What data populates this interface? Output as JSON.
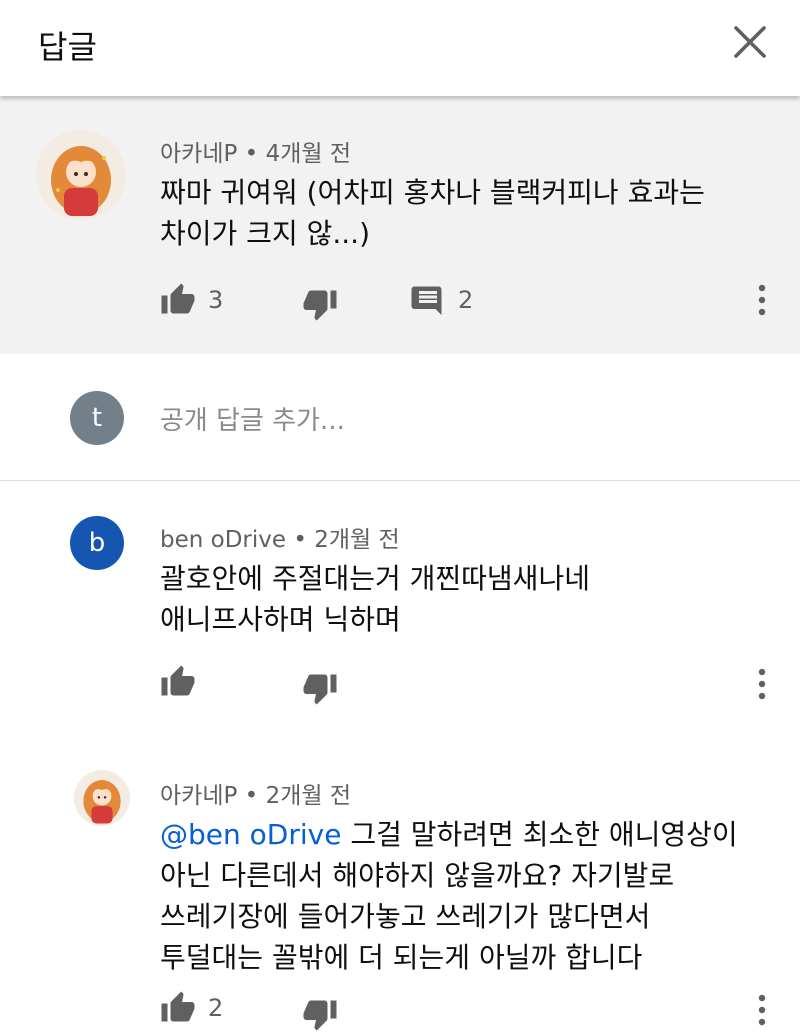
{
  "header": {
    "title": "답글"
  },
  "parent_comment": {
    "author": "아카네P",
    "time": "4개월 전",
    "text": "짜마 귀여워 (어차피 홍차나 블랙커피나 효과는\n차이가 크지 않...)",
    "likes": "3",
    "replies": "2"
  },
  "reply_input": {
    "avatar_letter": "t",
    "placeholder": "공개 답글 추가..."
  },
  "replies": [
    {
      "author": "ben oDrive",
      "time": "2개월 전",
      "avatar_letter": "b",
      "text": "괄호안에 주절대는거 개찐따냄새나네\n애니프사하며 닉하며"
    },
    {
      "author": "아카네P",
      "time": "2개월 전",
      "mention": "@ben oDrive",
      "text": " 그걸 말하려면 최소한 애니영상이\n아닌 다른데서 해야하지 않을까요? 자기발로\n쓰레기장에 들어가놓고 쓰레기가 많다면서\n투덜대는 꼴밖에 더 되는게 아닐까 합니다",
      "likes": "2"
    }
  ],
  "colors": {
    "accent_link": "#065fd4",
    "parent_bg": "#f2f2f2",
    "avatar_t": "#737f89",
    "avatar_b": "#1557b0"
  }
}
